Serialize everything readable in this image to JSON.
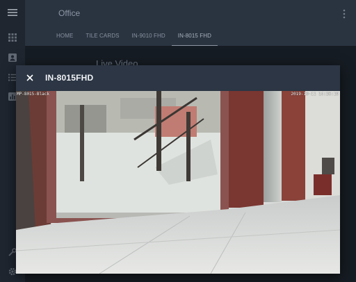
{
  "app": {
    "title": "Office"
  },
  "tabs": [
    {
      "label": "HOME",
      "active": false
    },
    {
      "label": "TILE CARDS",
      "active": false
    },
    {
      "label": "IN-9010 FHD",
      "active": false
    },
    {
      "label": "IN-8015 FHD",
      "active": true
    }
  ],
  "page": {
    "card_title": "Live Video"
  },
  "dialog": {
    "title": "IN-8015FHD",
    "close_icon": "close-icon"
  },
  "video": {
    "camera_label": "MP-8015-Black",
    "timestamp": "2019-10-11 14:26:19"
  },
  "rail": {
    "icons": [
      "menu-icon",
      "apps-icon",
      "account-box-icon",
      "list-icon",
      "chart-icon",
      "wrench-icon",
      "settings-icon"
    ]
  },
  "colors": {
    "header_bg": "#2a3441",
    "dialog_bar_bg": "#2c3644",
    "rail_bg": "#1f2630"
  }
}
